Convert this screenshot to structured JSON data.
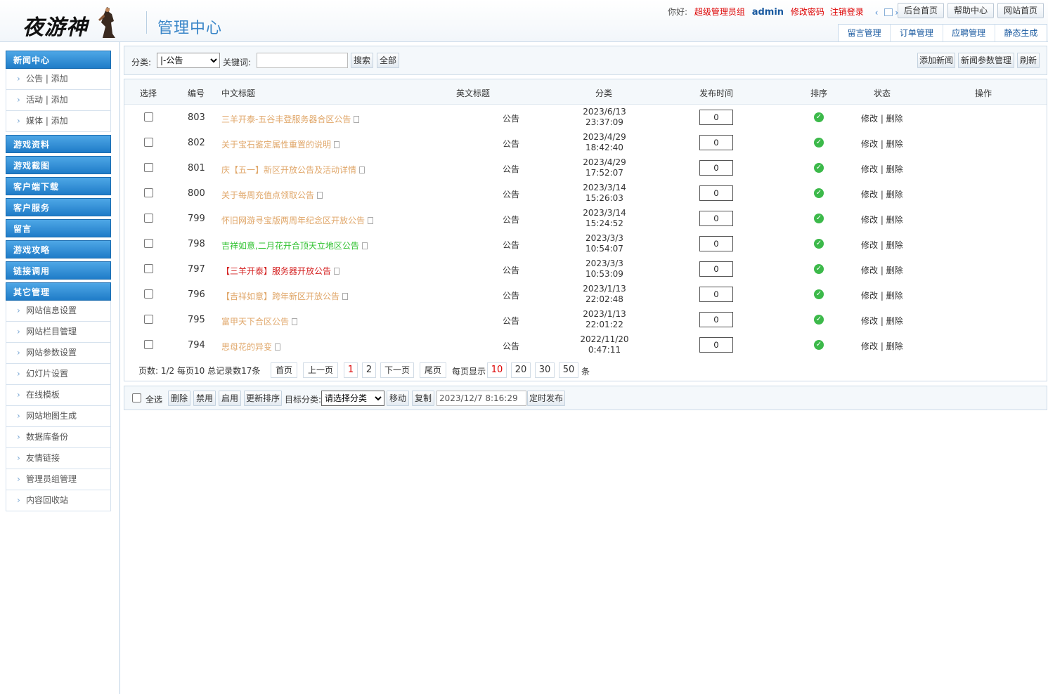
{
  "header": {
    "logo_text": "夜游神",
    "title": "管理中心",
    "greeting": "你好:",
    "role": "超级管理员组",
    "user": "admin",
    "change_pwd": "修改密码",
    "logout": "注销登录",
    "top_buttons": [
      "后台首页",
      "帮助中心",
      "网站首页"
    ],
    "tabs": [
      "留言管理",
      "订单管理",
      "应聘管理",
      "静态生成"
    ]
  },
  "sidebar": {
    "sections": [
      {
        "label": "新闻中心",
        "items": [
          "公告 | 添加",
          "活动 | 添加",
          "媒体 | 添加"
        ]
      },
      {
        "label": "游戏资料",
        "items": []
      },
      {
        "label": "游戏截图",
        "items": []
      },
      {
        "label": "客户端下载",
        "items": []
      },
      {
        "label": "客户服务",
        "items": []
      },
      {
        "label": "留言",
        "items": []
      },
      {
        "label": "游戏攻略",
        "items": []
      },
      {
        "label": "链接调用",
        "items": []
      },
      {
        "label": "其它管理",
        "items": [
          "网站信息设置",
          "网站栏目管理",
          "网站参数设置",
          "幻灯片设置",
          "在线模板",
          "网站地图生成",
          "数据库备份",
          "友情链接",
          "管理员组管理",
          "内容回收站"
        ]
      }
    ]
  },
  "search": {
    "category_label": "分类:",
    "category_value": "|-公告",
    "keyword_label": "关键词:",
    "keyword_value": "",
    "search_btn": "搜索",
    "all_btn": "全部",
    "add_btn": "添加新闻",
    "param_btn": "新闻参数管理",
    "refresh_btn": "刷新"
  },
  "table": {
    "columns": [
      "选择",
      "编号",
      "中文标题",
      "英文标题",
      "分类",
      "发布时间",
      "排序",
      "状态",
      "操作"
    ],
    "rows": [
      {
        "id": "803",
        "title": "三羊开泰-五谷丰登服务器合区公告",
        "color": "#e0a76a",
        "cat": "公告",
        "date": "2023/6/13",
        "time": "23:37:09",
        "sort": "0",
        "ops": "修改 | 删除"
      },
      {
        "id": "802",
        "title": "关于宝石鉴定属性重置的说明",
        "color": "#e0a76a",
        "cat": "公告",
        "date": "2023/4/29",
        "time": "18:42:40",
        "sort": "0",
        "ops": "修改 | 删除"
      },
      {
        "id": "801",
        "title": "庆【五一】新区开放公告及活动详情",
        "color": "#e0a76a",
        "cat": "公告",
        "date": "2023/4/29",
        "time": "17:52:07",
        "sort": "0",
        "ops": "修改 | 删除"
      },
      {
        "id": "800",
        "title": "关于每周充值点领取公告",
        "color": "#e0a76a",
        "cat": "公告",
        "date": "2023/3/14",
        "time": "15:26:03",
        "sort": "0",
        "ops": "修改 | 删除"
      },
      {
        "id": "799",
        "title": "怀旧网游寻宝版两周年纪念区开放公告",
        "color": "#e0a76a",
        "cat": "公告",
        "date": "2023/3/14",
        "time": "15:24:52",
        "sort": "0",
        "ops": "修改 | 删除"
      },
      {
        "id": "798",
        "title": "吉祥如意,二月花开合顶天立地区公告",
        "color": "#2fc22f",
        "cat": "公告",
        "date": "2023/3/3",
        "time": "10:54:07",
        "sort": "0",
        "ops": "修改 | 删除"
      },
      {
        "id": "797",
        "title": "【三羊开泰】服务器开放公告",
        "color": "#d42020",
        "cat": "公告",
        "date": "2023/3/3",
        "time": "10:53:09",
        "sort": "0",
        "ops": "修改 | 删除"
      },
      {
        "id": "796",
        "title": "【吉祥如意】跨年新区开放公告",
        "color": "#e0a76a",
        "cat": "公告",
        "date": "2023/1/13",
        "time": "22:02:48",
        "sort": "0",
        "ops": "修改 | 删除"
      },
      {
        "id": "795",
        "title": "富甲天下合区公告",
        "color": "#e0a76a",
        "cat": "公告",
        "date": "2023/1/13",
        "time": "22:01:22",
        "sort": "0",
        "ops": "修改 | 删除"
      },
      {
        "id": "794",
        "title": "思母花的异变",
        "color": "#e0a76a",
        "cat": "公告",
        "date": "2022/11/20",
        "time": "0:47:11",
        "sort": "0",
        "ops": "修改 | 删除"
      }
    ]
  },
  "pager": {
    "info": "页数:  1/2 每页10 总记录数17条",
    "first": "首页",
    "prev": "上一页",
    "pages": [
      "1",
      "2"
    ],
    "next": "下一页",
    "last": "尾页",
    "per_page_label": "每页显示",
    "per_page": [
      "10",
      "20",
      "30",
      "50"
    ],
    "unit": "条"
  },
  "bottom": {
    "select_all": "全选",
    "buttons": [
      "删除",
      "禁用",
      "启用",
      "更新排序"
    ],
    "target_label": "目标分类:",
    "target_value": "请选择分类",
    "move": "移动",
    "copy": "复制",
    "schedule_value": "2023/12/7 8:16:29",
    "schedule_btn": "定时发布"
  },
  "colors": {
    "accent": "#1f7cc8",
    "status_ok": "#3cb94a",
    "red": "#d00000"
  },
  "icons": [
    "check-circle-icon",
    "document-icon",
    "chevron-right-icon"
  ]
}
